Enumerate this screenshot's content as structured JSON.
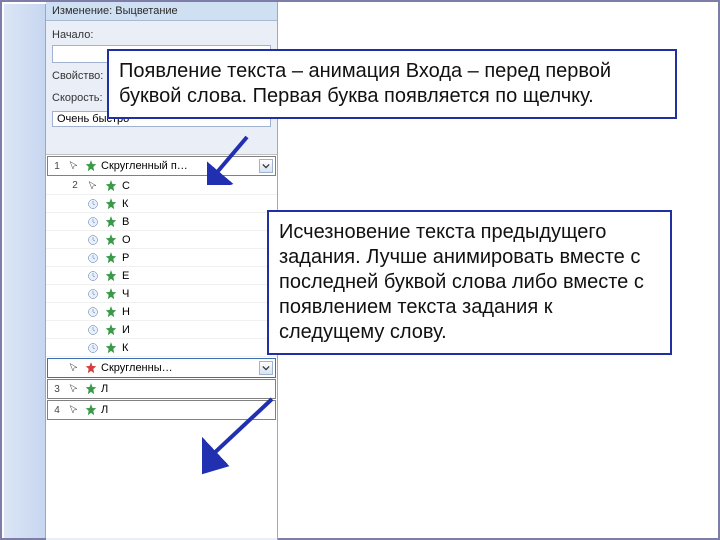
{
  "panel": {
    "header": "Изменение: Выцветание",
    "start_label": "Начало:",
    "property_label": "Свойство:",
    "speed_label": "Скорость:",
    "speed_value": "Очень быстро",
    "groups": [
      {
        "num": "1",
        "trigger": "mouse",
        "star": "green",
        "label": "Скругленный п…",
        "dropdown": true
      },
      {
        "num": "2",
        "trigger": "mouse",
        "children": [
          {
            "trigger": "",
            "star": "green",
            "label": "С"
          },
          {
            "trigger": "clock",
            "star": "green",
            "label": "К"
          },
          {
            "trigger": "clock",
            "star": "green",
            "label": "В"
          },
          {
            "trigger": "clock",
            "star": "green",
            "label": "О"
          },
          {
            "trigger": "clock",
            "star": "green",
            "label": "Р"
          },
          {
            "trigger": "clock",
            "star": "green",
            "label": "Е"
          },
          {
            "trigger": "clock",
            "star": "green",
            "label": "Ч"
          },
          {
            "trigger": "clock",
            "star": "green",
            "label": "Н"
          },
          {
            "trigger": "clock",
            "star": "green",
            "label": "И"
          },
          {
            "trigger": "clock",
            "star": "green",
            "label": "К"
          }
        ]
      },
      {
        "num": "",
        "trigger": "mouse",
        "star": "red",
        "label": "Скругленны…",
        "dropdown": true,
        "sel": true
      },
      {
        "num": "3",
        "trigger": "mouse",
        "star": "green",
        "label": "Л"
      },
      {
        "num": "4",
        "trigger": "mouse",
        "star": "green",
        "label": "Л"
      }
    ]
  },
  "callouts": {
    "top": "Появление текста – анимация Входа – перед первой буквой слова. Первая буква появляется по щелчку.",
    "bottom": "Исчезновение текста предыдущего задания. Лучше анимировать вместе с последней буквой слова либо вместе с появлением текста задания к следущему слову."
  }
}
